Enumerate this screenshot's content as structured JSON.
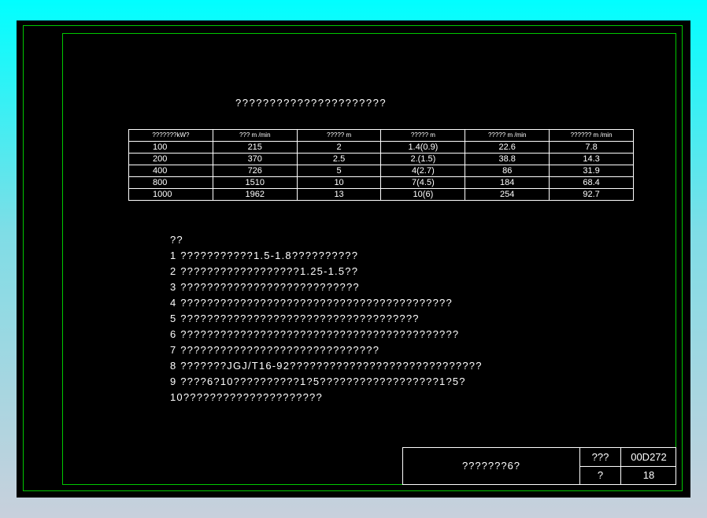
{
  "title": "??????????????????????",
  "table": {
    "headers": [
      "???????kW?",
      "??? m /min",
      "????? m",
      "????? m",
      "????? m /min",
      "?????? m /min"
    ],
    "rows": [
      [
        "100",
        "215",
        "2",
        "1.4(0.9)",
        "22.6",
        "7.8"
      ],
      [
        "200",
        "370",
        "2.5",
        "2.(1.5)",
        "38.8",
        "14.3"
      ],
      [
        "400",
        "726",
        "5",
        "4(2.7)",
        "86",
        "31.9"
      ],
      [
        "800",
        "1510",
        "10",
        "7(4.5)",
        "184",
        "68.4"
      ],
      [
        "1000",
        "1962",
        "13",
        "10(6)",
        "254",
        "92.7"
      ]
    ]
  },
  "notes": [
    "??",
    "1 ???????????1.5-1.8??????????",
    "2 ??????????????????1.25-1.5??",
    "3 ???????????????????????????",
    "4 ?????????????????????????????????????????",
    "5 ????????????????????????????????????",
    "6 ??????????????????????????????????????????",
    "7 ??????????????????????????????",
    "8 ???????JGJ/T16-92?????????????????????????????",
    "9 ????6?10??????????1?5??????????????????1?5?",
    "10?????????????????????"
  ],
  "titleblock": {
    "name": "???????6?",
    "atlas_label": "???",
    "atlas_number": "00D272",
    "page_label": "?",
    "page_number": "18"
  },
  "colors": {
    "background": "#000000",
    "frame": "#00c800",
    "text": "#ffffff"
  }
}
